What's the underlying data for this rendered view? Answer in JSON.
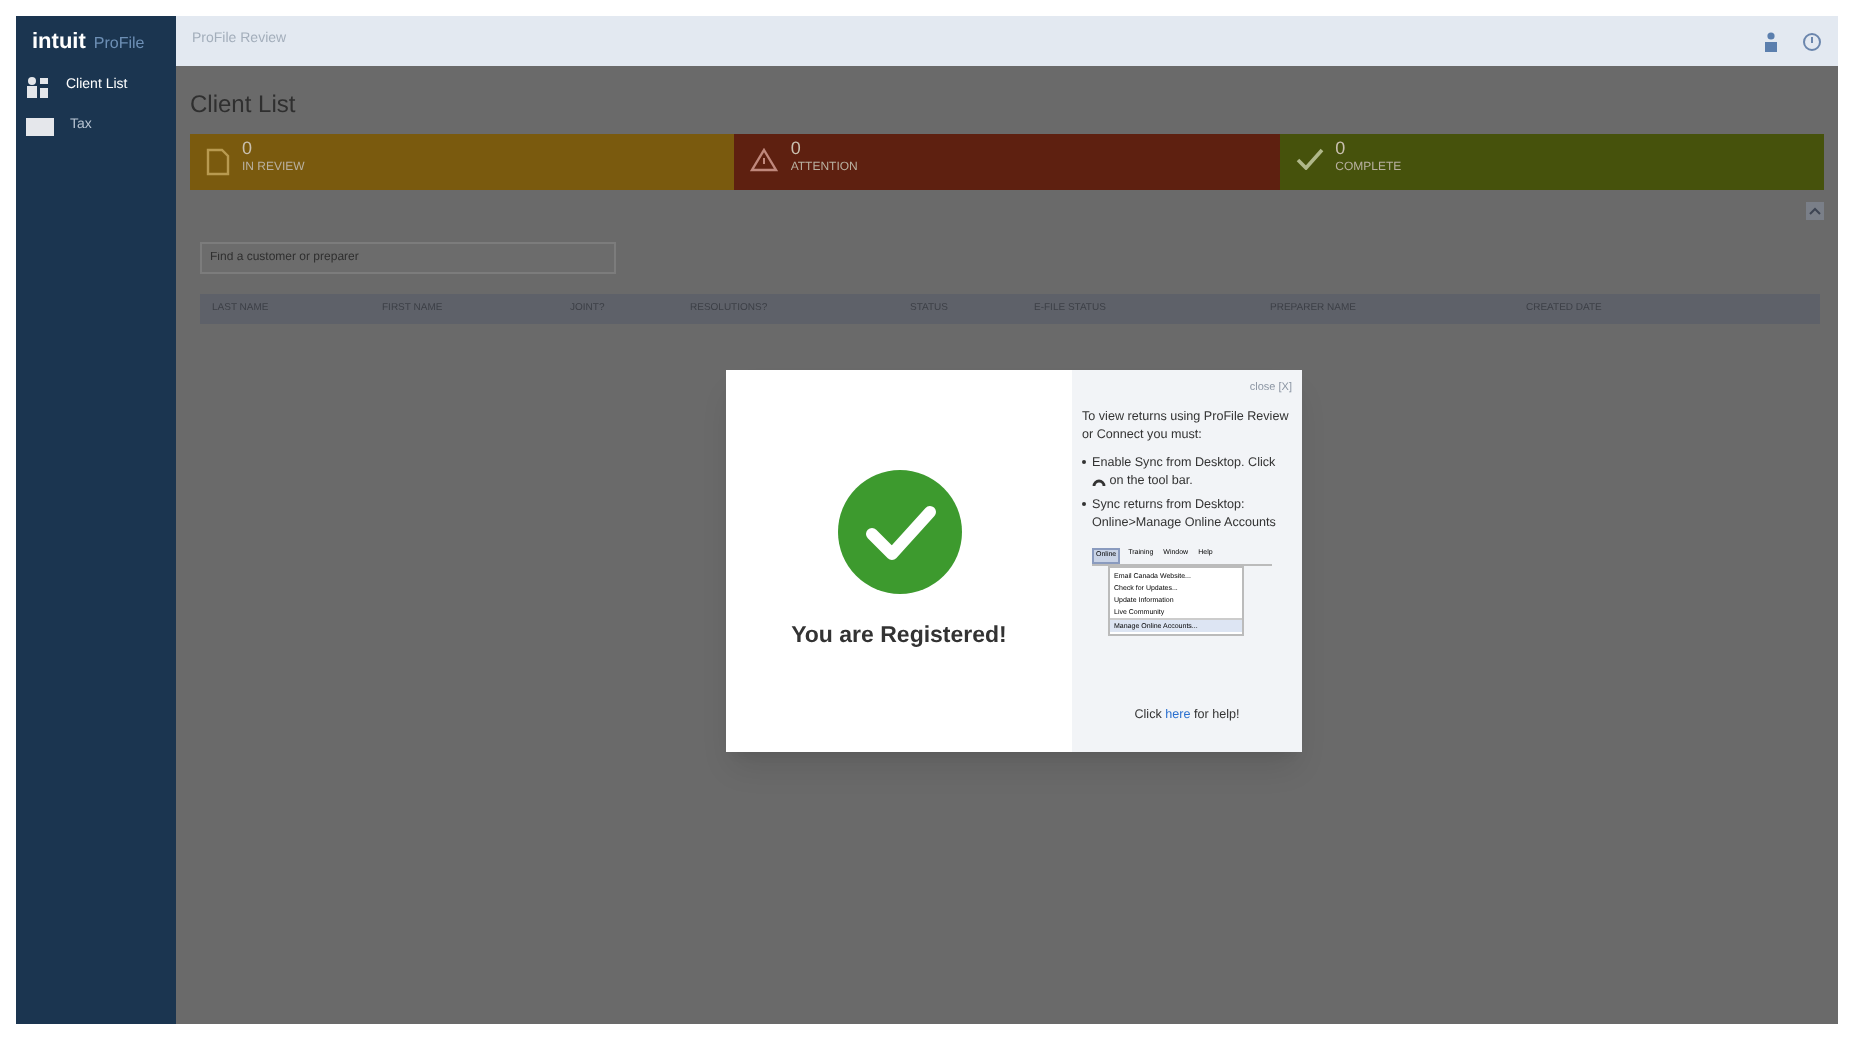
{
  "sidebar": {
    "brand": "intuit",
    "product": "ProFile",
    "items": [
      {
        "label": "Client List",
        "kind": "people",
        "selected": true
      },
      {
        "label": "Tax",
        "kind": "folder",
        "selected": false
      }
    ]
  },
  "header": {
    "title": "ProFile Review"
  },
  "page": {
    "title": "Client List"
  },
  "status_cards": [
    {
      "kind": "review",
      "count": "0",
      "label": "IN REVIEW",
      "color": "#7a5a0e"
    },
    {
      "kind": "attention",
      "count": "0",
      "label": "ATTENTION",
      "color": "#5e2010"
    },
    {
      "kind": "complete",
      "count": "0",
      "label": "COMPLETE",
      "color": "#46520c"
    }
  ],
  "search": {
    "placeholder": "Find a customer or preparer"
  },
  "table": {
    "columns": [
      "LAST NAME",
      "FIRST NAME",
      "JOINT?",
      "RESOLUTIONS?",
      "STATUS",
      "E-FILE STATUS",
      "PREPARER NAME",
      "CREATED DATE"
    ]
  },
  "dialog": {
    "message": "You are Registered!",
    "close": "close [X]",
    "intro": "To view returns using ProFile Review or Connect you must:",
    "steps": [
      {
        "before": "Enable Sync from Desktop. Click",
        "after": "on the tool bar."
      },
      {
        "before": "Sync returns from Desktop: Online>Manage Online Accounts"
      }
    ],
    "menu_shot": {
      "menus": [
        "Online",
        "Training",
        "Window",
        "Help"
      ],
      "items": [
        "Email Canada Website...",
        "Check for Updates...",
        "Update Information",
        "Live Community",
        "Manage Online Accounts..."
      ]
    },
    "help_before": "Click",
    "help_link": "here",
    "help_after": "for help!"
  }
}
